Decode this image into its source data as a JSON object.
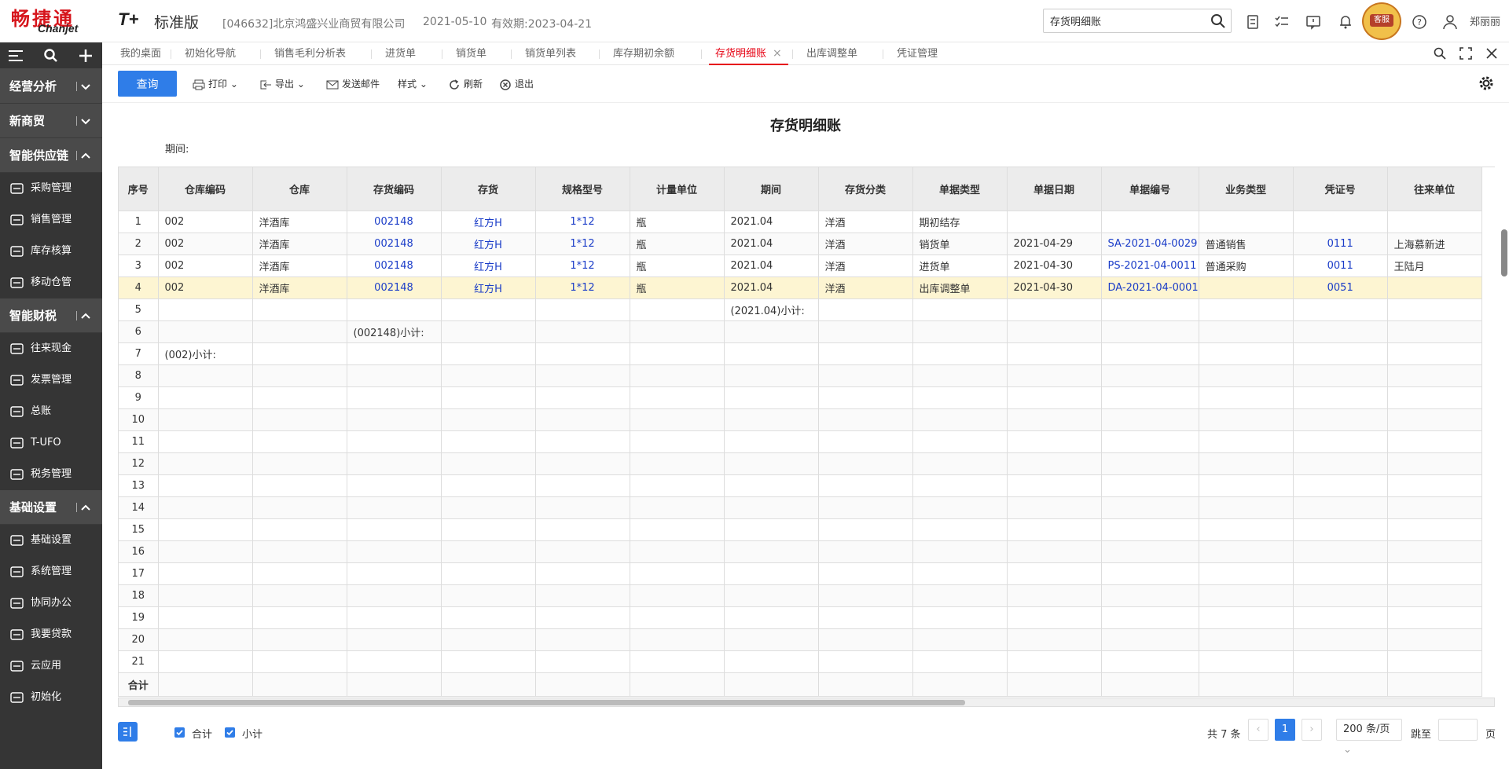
{
  "header": {
    "logo_cn": "畅捷通",
    "logo_en": "Chanjet",
    "brand": "T+",
    "edition": "标准版",
    "company": "[046632]北京鸿盛兴业商贸有限公司",
    "login_date": "2021-05-10",
    "valid": "有效期:2023-04-21",
    "search_value": "存货明细账",
    "user": "郑丽丽",
    "badge": "客服"
  },
  "sidebar": {
    "sections": [
      {
        "label": "经营分析",
        "items": []
      },
      {
        "label": "新商贸",
        "items": []
      },
      {
        "label": "智能供应链",
        "items": [
          "采购管理",
          "销售管理",
          "库存核算",
          "移动仓管"
        ]
      },
      {
        "label": "智能财税",
        "items": [
          "往来现金",
          "发票管理",
          "总账",
          "T-UFO",
          "税务管理"
        ]
      },
      {
        "label": "基础设置",
        "items": [
          "基础设置",
          "系统管理",
          "协同办公",
          "我要贷款",
          "云应用",
          "初始化"
        ]
      }
    ]
  },
  "tabs": [
    "我的桌面",
    "初始化导航",
    "销售毛利分析表",
    "进货单",
    "销货单",
    "销货单列表",
    "库存期初余额",
    "存货明细账",
    "出库调整单",
    "凭证管理"
  ],
  "active_tab": "存货明细账",
  "toolbar": {
    "query": "查询",
    "print": "打印",
    "export": "导出",
    "email": "发送邮件",
    "style": "样式",
    "refresh": "刷新",
    "exit": "退出"
  },
  "report": {
    "title": "存货明细账",
    "period_label": "期间:"
  },
  "table": {
    "columns": [
      "序号",
      "仓库编码",
      "仓库",
      "存货编码",
      "存货",
      "规格型号",
      "计量单位",
      "期间",
      "存货分类",
      "单据类型",
      "单据日期",
      "单据编号",
      "业务类型",
      "凭证号",
      "往来单位"
    ],
    "rows": [
      [
        "1",
        "002",
        "洋酒库",
        "002148",
        "红方H",
        "1*12",
        "瓶",
        "2021.04",
        "洋酒",
        "期初结存",
        "",
        "",
        "",
        "",
        ""
      ],
      [
        "2",
        "002",
        "洋酒库",
        "002148",
        "红方H",
        "1*12",
        "瓶",
        "2021.04",
        "洋酒",
        "销货单",
        "2021-04-29",
        "SA-2021-04-0029",
        "普通销售",
        "0111",
        "上海慕新进"
      ],
      [
        "3",
        "002",
        "洋酒库",
        "002148",
        "红方H",
        "1*12",
        "瓶",
        "2021.04",
        "洋酒",
        "进货单",
        "2021-04-30",
        "PS-2021-04-0011",
        "普通采购",
        "0011",
        "王陆月"
      ],
      [
        "4",
        "002",
        "洋酒库",
        "002148",
        "红方H",
        "1*12",
        "瓶",
        "2021.04",
        "洋酒",
        "出库调整单",
        "2021-04-30",
        "DA-2021-04-0001",
        "",
        "0051",
        ""
      ],
      [
        "5",
        "",
        "",
        "",
        "",
        "",
        "",
        "(2021.04)小计:",
        "",
        "",
        "",
        "",
        "",
        "",
        ""
      ],
      [
        "6",
        "",
        "",
        "(002148)小计:",
        "",
        "",
        "",
        "",
        "",
        "",
        "",
        "",
        "",
        "",
        ""
      ],
      [
        "7",
        "(002)小计:",
        "",
        "",
        "",
        "",
        "",
        "",
        "",
        "",
        "",
        "",
        "",
        "",
        ""
      ],
      [
        "8"
      ],
      [
        "9"
      ],
      [
        "10"
      ],
      [
        "11"
      ],
      [
        "12"
      ],
      [
        "13"
      ],
      [
        "14"
      ],
      [
        "15"
      ],
      [
        "16"
      ],
      [
        "17"
      ],
      [
        "18"
      ],
      [
        "19"
      ],
      [
        "20"
      ],
      [
        "21"
      ]
    ],
    "total_label": "合计"
  },
  "footer": {
    "cb_total": "合计",
    "cb_subtotal": "小计",
    "count": "共 7 条",
    "current_page": "1",
    "page_size": "200 条/页",
    "jump": "跳至",
    "page": "页"
  }
}
